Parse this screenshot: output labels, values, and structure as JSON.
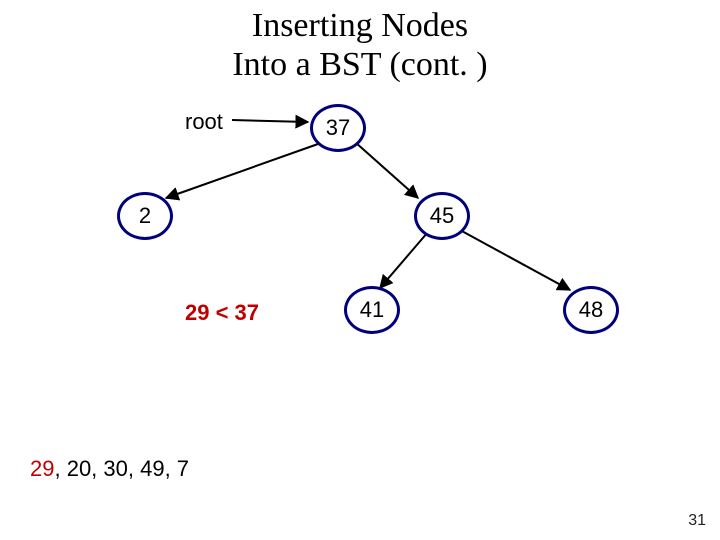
{
  "title_line1": "Inserting Nodes",
  "title_line2": "Into a BST (cont. )",
  "root_label": "root",
  "nodes": {
    "n37": "37",
    "n2": "2",
    "n45": "45",
    "n41": "41",
    "n48": "48"
  },
  "comparison": "29 < 37",
  "queue_highlight": "29",
  "queue_rest": ", 20, 30, 49, 7",
  "page_number": "31",
  "chart_data": {
    "type": "diagram",
    "title": "Inserting Nodes Into a BST (cont.)",
    "description": "Binary search tree with root 37; left child 2; right child 45; 45 has children 41 and 48. Current insertion comparison shown.",
    "root_pointer_target": 37,
    "tree": {
      "value": 37,
      "left": {
        "value": 2
      },
      "right": {
        "value": 45,
        "left": {
          "value": 41
        },
        "right": {
          "value": 48
        }
      }
    },
    "edges": [
      {
        "from": "root-label",
        "to": 37
      },
      {
        "from": 37,
        "to": 2
      },
      {
        "from": 37,
        "to": 45
      },
      {
        "from": 45,
        "to": 41
      },
      {
        "from": 45,
        "to": 48
      }
    ],
    "current_comparison": {
      "value": 29,
      "against": 37,
      "result": "less"
    },
    "insertion_queue": [
      29,
      20,
      30,
      49,
      7
    ],
    "queue_current_index": 0,
    "slide_number": 31
  }
}
